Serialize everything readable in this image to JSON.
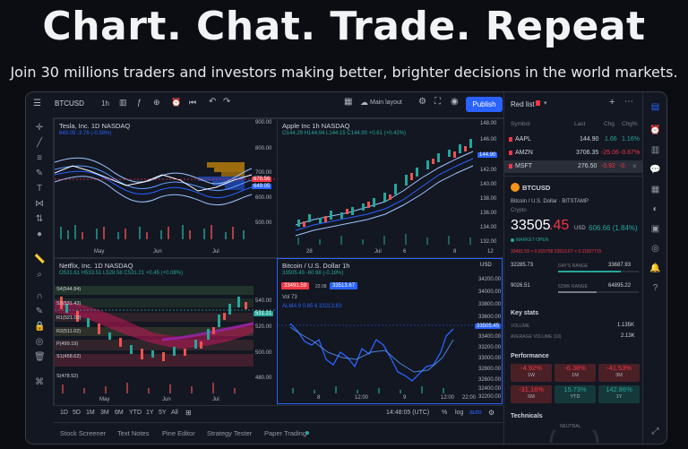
{
  "hero": {
    "title": "Chart. Chat. Trade. Repeat",
    "subtitle": "Join 30 millions traders and investors making better, brighter decisions in the world markets."
  },
  "toolbar": {
    "symbol": "BTCUSD",
    "interval": "1h",
    "layout_label": "Main layout",
    "publish_label": "Publish"
  },
  "panes": [
    {
      "title": "Tesla, Inc.  1D  NASDAQ",
      "ohlc": "649.05  -3.76 (-0.58%)",
      "axis": [
        "900.00",
        "800.00",
        "700.00",
        "600.00",
        "500.00"
      ],
      "tags": [
        "678.56",
        "649.05"
      ],
      "x_labels": [
        "May",
        "Jun",
        "Jul"
      ]
    },
    {
      "title": "Apple Inc  1h  NASDAQ",
      "ohlc": "O144.29  H144.94  L144.15  C144.90  +0.61 (+0.42%)",
      "axis": [
        "148.00",
        "146.00",
        "142.00",
        "140.00",
        "138.00",
        "136.00",
        "134.00",
        "132.00"
      ],
      "tags": [
        "144.90"
      ],
      "x_labels": [
        "28",
        "Jul",
        "6",
        "8",
        "12"
      ]
    },
    {
      "title": "Netflix, Inc.  1D  NASDAQ",
      "ohlc": "O531.61  H533.51  L528.56  C531.21  +0.45 (+0.08%)",
      "axis": [
        "540.00",
        "520.00",
        "500.00",
        "480.00"
      ],
      "tags": [
        "531.21"
      ],
      "levels": [
        "S4(544.84)",
        "S3(531.43)",
        "R1(521.03)",
        "R2(511.02)",
        "P(499.19)",
        "S1(458.62)",
        "S(478.52)"
      ],
      "x_labels": [
        "May",
        "Jun",
        "Jul"
      ]
    },
    {
      "title": "Bitcoin / U.S. Dollar  1h",
      "currency": "USD",
      "ohlc": "33505.45  -60.98 (-0.18%)",
      "sell": "33491.59",
      "buy": "33513.67",
      "spread": "22.08",
      "vol": "Vol  73",
      "alma": "ALMA 9  0.85  6   33213.83",
      "axis": [
        "34200.00",
        "34000.00",
        "33800.00",
        "33600.00",
        "33400.00",
        "33200.00",
        "33000.00",
        "32800.00",
        "32600.00",
        "32400.00",
        "32200.00"
      ],
      "tags": [
        "33505.45"
      ],
      "x_labels": [
        "8",
        "12:00",
        "9",
        "12:00",
        "22:00"
      ]
    }
  ],
  "bottom": {
    "ranges": [
      "1D",
      "5D",
      "1M",
      "3M",
      "6M",
      "YTD",
      "1Y",
      "5Y",
      "All"
    ],
    "time": "14:48:05 (UTC)",
    "percent": "%",
    "log": "log",
    "auto": "auto"
  },
  "tabs": [
    "Stock Screener",
    "Text Notes",
    "Pine Editor",
    "Strategy Tester",
    "Paper Trading"
  ],
  "watchlist": {
    "title": "Red list",
    "headers": [
      "Symbol",
      "Last",
      "Chg",
      "Chg%"
    ],
    "rows": [
      {
        "symbol": "AAPL",
        "last": "144.90",
        "chg": "1.66",
        "chgp": "1.16%",
        "up": true
      },
      {
        "symbol": "AMZN",
        "last": "3706.35",
        "chg": "-25.06",
        "chgp": "-0.67%",
        "up": false
      },
      {
        "symbol": "MSFT",
        "last": "276.50",
        "chg": "-0.92",
        "chgp": "-0.",
        "up": false
      }
    ]
  },
  "details": {
    "symbol": "BTCUSD",
    "name": "Bitcoin / U.S. Dollar  ·  BITSTAMP",
    "type": "Crypto",
    "price_main": "33505",
    "price_dec": ".45",
    "currency": "USD",
    "change": "606.66 (1.84%)",
    "market": "MARKET OPEN",
    "bid_ask": "33491.59 × 0.915758     33513.67 × 0.11657715",
    "day_low": "32285.73",
    "day_label": "DAY'S RANGE",
    "day_high": "33687.93",
    "wk_low": "9026.51",
    "wk_label": "52WK RANGE",
    "wk_high": "64895.22",
    "key_stats": "Key stats",
    "volume_label": "VOLUME",
    "volume": "1.135K",
    "avg_label": "AVERAGE VOLUME (10)",
    "avg": "2.13K",
    "performance": "Performance",
    "perf": [
      {
        "v": "-4.92%",
        "p": "1W",
        "up": false
      },
      {
        "v": "-6.38%",
        "p": "1M",
        "up": false
      },
      {
        "v": "-41.53%",
        "p": "3M",
        "up": false
      },
      {
        "v": "-31.16%",
        "p": "6M",
        "up": false
      },
      {
        "v": "15.73%",
        "p": "YTD",
        "up": true
      },
      {
        "v": "142.86%",
        "p": "1Y",
        "up": true
      }
    ],
    "technicals": "Technicals",
    "neutral": "NEUTRAL"
  }
}
